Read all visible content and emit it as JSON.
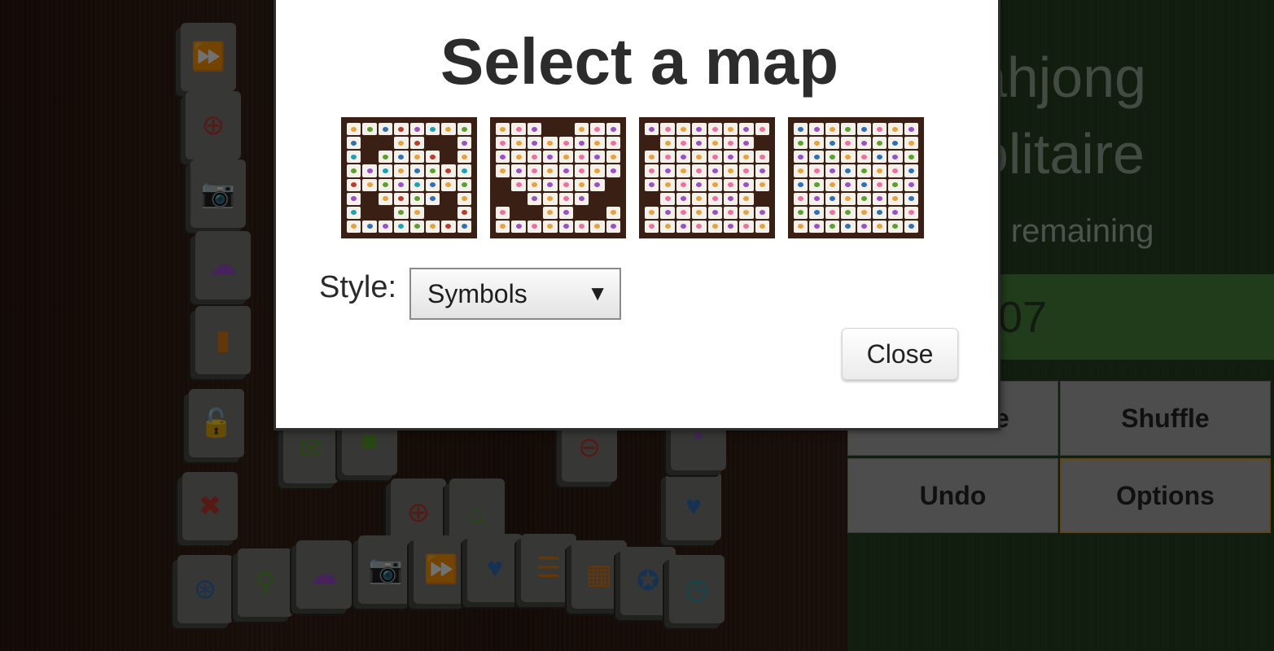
{
  "panel": {
    "title_line1": "ahjong",
    "title_line2": "olitaire",
    "pairs_text": "irs remaining",
    "timer_text": "07",
    "buttons": {
      "hint_partial": "e",
      "shuffle": "Shuffle",
      "undo": "Undo",
      "options": "Options"
    }
  },
  "modal": {
    "title": "Select a map",
    "maps": [
      {
        "name": "map-1"
      },
      {
        "name": "map-2"
      },
      {
        "name": "map-3"
      },
      {
        "name": "map-4"
      }
    ],
    "style_label": "Style:",
    "style_selected": "Symbols",
    "close_label": "Close"
  },
  "tiles": [
    {
      "icon": "fast-forward-icon",
      "glyph": "⏩",
      "color": "#2f6fb8"
    },
    {
      "icon": "plus-circle-icon",
      "glyph": "⊕",
      "color": "#c0392b"
    },
    {
      "icon": "camera-icon",
      "glyph": "📷",
      "color": "#1aa3b8"
    },
    {
      "icon": "cloud-download-icon",
      "glyph": "☁",
      "color": "#9b4fc9"
    },
    {
      "icon": "signal-bars-icon",
      "glyph": "▮",
      "color": "#d97a14"
    },
    {
      "icon": "unlock-icon",
      "glyph": "🔓",
      "color": "#e07b12"
    },
    {
      "icon": "close-icon",
      "glyph": "✖",
      "color": "#c0392b"
    },
    {
      "icon": "film-reel-icon",
      "glyph": "⊛",
      "color": "#2f6fb8"
    },
    {
      "icon": "search-icon",
      "glyph": "⚲",
      "color": "#5aa02c"
    },
    {
      "icon": "heart-icon",
      "glyph": "♥",
      "color": "#2f6fb8"
    },
    {
      "icon": "home-icon",
      "glyph": "⌂",
      "color": "#5aa02c"
    },
    {
      "icon": "list-icon",
      "glyph": "☰",
      "color": "#d97a14"
    },
    {
      "icon": "grid-icon",
      "glyph": "▦",
      "color": "#d97a14"
    },
    {
      "icon": "award-icon",
      "glyph": "✪",
      "color": "#2f6fb8"
    },
    {
      "icon": "clock-icon",
      "glyph": "◷",
      "color": "#1aa3b8"
    }
  ]
}
